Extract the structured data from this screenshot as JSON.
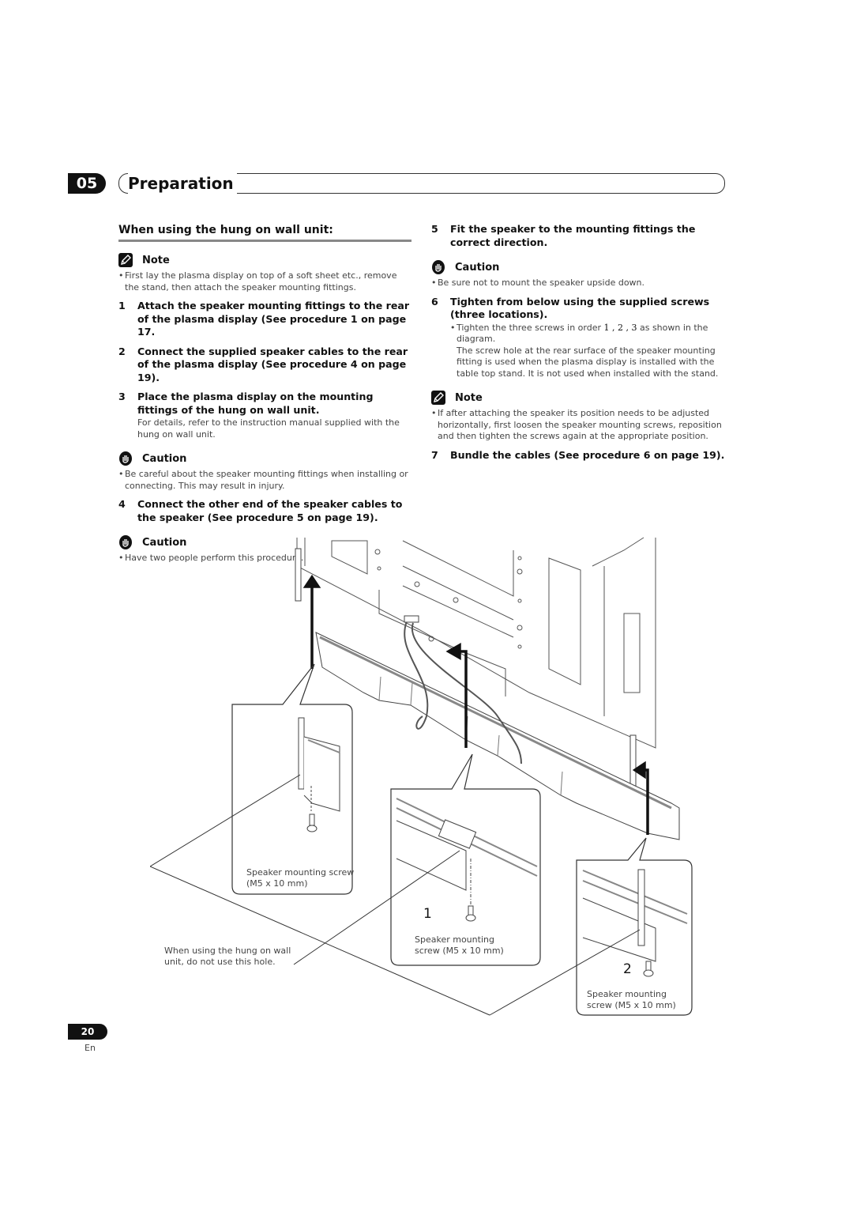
{
  "chapter": {
    "number": "05",
    "title": "Preparation"
  },
  "left_column": {
    "section_title": "When using the hung on wall unit:",
    "note1": {
      "label": "Note",
      "icon": "pencil-note-icon",
      "bullets": [
        "First lay the plasma display on top of a soft sheet etc., remove the stand, then attach the speaker mounting fittings."
      ]
    },
    "steps_a": [
      {
        "n": "1",
        "text": "Attach the speaker mounting fittings to the rear of the plasma display (See procedure 1 on page 17."
      },
      {
        "n": "2",
        "text": "Connect the supplied speaker cables to the rear of the plasma display (See procedure 4 on page 19)."
      },
      {
        "n": "3",
        "text": "Place the plasma display on the mounting fittings of the hung on wall unit.",
        "detail": "For details, refer to the instruction manual supplied with the hung on wall unit."
      }
    ],
    "caution1": {
      "label": "Caution",
      "icon": "hand-caution-icon",
      "bullets": [
        "Be careful about the speaker mounting fittings when installing or connecting. This may result in injury."
      ]
    },
    "step4": {
      "n": "4",
      "text": "Connect the other end of the speaker cables to the speaker (See procedure 5 on page 19)."
    },
    "caution2": {
      "label": "Caution",
      "icon": "hand-caution-icon",
      "bullets": [
        "Have two people perform this procedure."
      ]
    }
  },
  "right_column": {
    "step5": {
      "n": "5",
      "text": "Fit the speaker to the mounting fittings the correct direction."
    },
    "caution3": {
      "label": "Caution",
      "icon": "hand-caution-icon",
      "bullets": [
        "Be sure not to mount the speaker upside down."
      ]
    },
    "step6": {
      "n": "6",
      "text": "Tighten from below using the supplied screws (three locations).",
      "detail_prefix": "Tighten the three screws in order ",
      "order": "1 , 2 , 3",
      "detail_suffix": "  as shown in the diagram.",
      "detail2": "The screw hole at the rear surface of the speaker mounting fitting is used when the plasma display is installed with the table top stand. It is not used when installed with the stand."
    },
    "note2": {
      "label": "Note",
      "icon": "pencil-note-icon",
      "bullets": [
        "If after attaching the speaker its position needs to be adjusted horizontally, first loosen the speaker mounting screws, reposition and then tighten the screws again at the appropriate position."
      ]
    },
    "step7": {
      "n": "7",
      "text": "Bundle the cables (See procedure 6 on page 19)."
    }
  },
  "illustration": {
    "callout_left_label_line1": "Speaker mounting screw",
    "callout_left_label_line2": "(M5 x 10 mm)",
    "callout_mid_number": "1",
    "callout_mid_label_line1": "Speaker mounting",
    "callout_mid_label_line2": "screw (M5 x 10 mm)",
    "callout_right_number": "2",
    "callout_right_label_line1": "Speaker mounting",
    "callout_right_label_line2": "screw (M5 x 10 mm)",
    "hole_warning_line1": "When using the hung on wall",
    "hole_warning_line2": "unit, do not use this hole."
  },
  "footer": {
    "page": "20",
    "lang": "En"
  }
}
